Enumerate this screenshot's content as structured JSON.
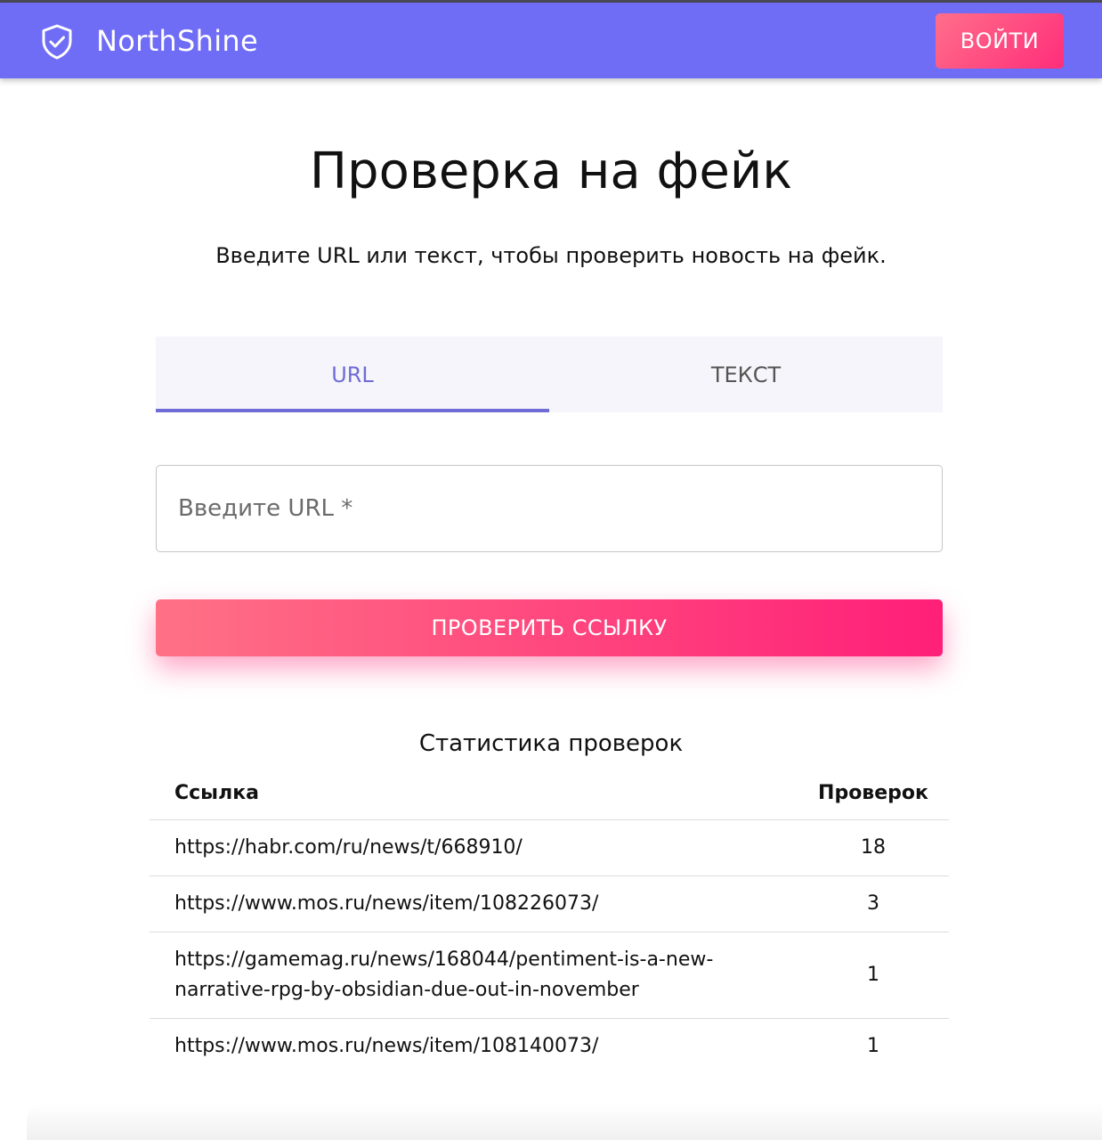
{
  "header": {
    "brand": "NorthShine",
    "login_label": "ВОЙТИ",
    "logo_icon": "shield-check-icon",
    "color": "#6f6cf6"
  },
  "main": {
    "title": "Проверка на фейк",
    "subtitle": "Введите URL или текст, чтобы проверить новость на фейк.",
    "tabs": [
      {
        "label": "URL",
        "active": true
      },
      {
        "label": "ТЕКСТ",
        "active": false
      }
    ],
    "url_input": {
      "placeholder": "Введите URL *",
      "value": ""
    },
    "check_button_label": "ПРОВЕРИТЬ ССЫЛКУ",
    "accent_color": "#ff2d7a"
  },
  "stats": {
    "title": "Статистика проверок",
    "columns": [
      "Ссылка",
      "Проверок"
    ],
    "rows": [
      {
        "link": "https://habr.com/ru/news/t/668910/",
        "count": "18"
      },
      {
        "link": "https://www.mos.ru/news/item/108226073/",
        "count": "3"
      },
      {
        "link": "https://gamemag.ru/news/168044/pentiment-is-a-new-narrative-rpg-by-obsidian-due-out-in-november",
        "count": "1"
      },
      {
        "link": "https://www.mos.ru/news/item/108140073/",
        "count": "1"
      }
    ]
  }
}
